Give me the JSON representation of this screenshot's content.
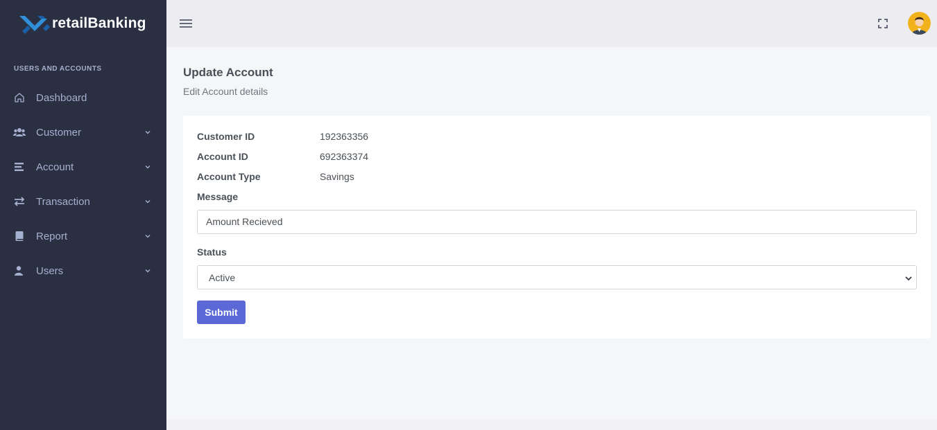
{
  "brand": {
    "name": "retailBanking"
  },
  "sidebar": {
    "section_title": "USERS AND ACCOUNTS",
    "items": [
      {
        "label": "Dashboard",
        "icon": "home-icon",
        "has_submenu": false
      },
      {
        "label": "Customer",
        "icon": "users-icon",
        "has_submenu": true
      },
      {
        "label": "Account",
        "icon": "list-icon",
        "has_submenu": true
      },
      {
        "label": "Transaction",
        "icon": "exchange-icon",
        "has_submenu": true
      },
      {
        "label": "Report",
        "icon": "book-icon",
        "has_submenu": true
      },
      {
        "label": "Users",
        "icon": "user-cog-icon",
        "has_submenu": true
      }
    ]
  },
  "topbar": {
    "menu_icon": "hamburger-icon",
    "fullscreen_icon": "fullscreen-icon",
    "avatar_icon": "user-avatar-icon"
  },
  "page": {
    "title": "Update Account",
    "subtitle": "Edit Account details"
  },
  "form": {
    "details": [
      {
        "label": "Customer ID",
        "value": "192363356"
      },
      {
        "label": "Account ID",
        "value": "692363374"
      },
      {
        "label": "Account Type",
        "value": "Savings"
      }
    ],
    "message_label": "Message",
    "message_value": "Amount Recieved",
    "status_label": "Status",
    "status_value": "Active",
    "submit_label": "Submit"
  },
  "colors": {
    "sidebar_bg": "#2a3042",
    "sidebar_text": "#a6b0cf",
    "topbar_bg": "#ececf1",
    "content_bg": "#f5f6f8",
    "primary": "#5b68d6",
    "logo_blue": "#2f8fd8",
    "logo_dark_blue": "#1a5fa8"
  }
}
